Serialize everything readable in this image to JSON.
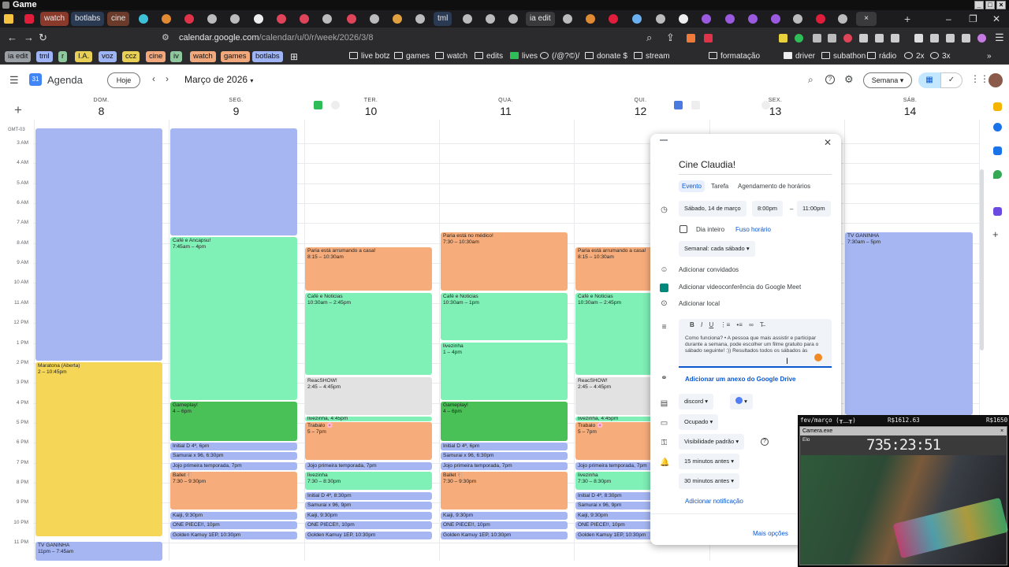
{
  "window": {
    "title": "Game"
  },
  "tabs": [
    "watch",
    "botlabs",
    "cine",
    "tml",
    "ia edit"
  ],
  "address": {
    "domain": "calendar.google.com",
    "path": "/calendar/u/0/r/week/2026/3/8"
  },
  "bookmarks": {
    "chips": [
      {
        "label": "ia edit",
        "color": "#9aa0a6"
      },
      {
        "label": "tml",
        "color": "#9fb4f5"
      },
      {
        "label": "r",
        "color": "#8fc79f"
      },
      {
        "label": "I.A.",
        "color": "#e8cf56"
      },
      {
        "label": "voz",
        "color": "#9fb4f5"
      },
      {
        "label": "ccz",
        "color": "#e8cf56"
      },
      {
        "label": "cine",
        "color": "#f2a87d"
      },
      {
        "label": "iv",
        "color": "#8fc79f"
      },
      {
        "label": "watch",
        "color": "#f2a87d"
      },
      {
        "label": "games",
        "color": "#f2a87d"
      },
      {
        "label": "botlabs",
        "color": "#9fb4f5"
      }
    ],
    "folders": [
      "live botz",
      "games",
      "watch",
      "edits",
      "lives",
      "(/@?©)/",
      "donate $",
      "stream",
      "formatação",
      "driver",
      "subathon",
      "rádio",
      "2x",
      "3x"
    ]
  },
  "calendar": {
    "app_name": "Agenda",
    "today_btn": "Hoje",
    "month": "Março de 2026",
    "view": "Semana",
    "timezone": "GMT-03",
    "hours": [
      "3 AM",
      "4 AM",
      "5 AM",
      "6 AM",
      "7 AM",
      "8 AM",
      "9 AM",
      "10 AM",
      "11 AM",
      "12 PM",
      "1 PM",
      "2 PM",
      "3 PM",
      "4 PM",
      "5 PM",
      "6 PM",
      "7 PM",
      "8 PM",
      "9 PM",
      "10 PM",
      "11 PM"
    ],
    "days": [
      {
        "name": "DOM.",
        "num": "8"
      },
      {
        "name": "SEG.",
        "num": "9"
      },
      {
        "name": "TER.",
        "num": "10"
      },
      {
        "name": "QUA.",
        "num": "11"
      },
      {
        "name": "QUI.",
        "num": "12"
      },
      {
        "name": "SEX.",
        "num": "13"
      },
      {
        "name": "SÁB.",
        "num": "14"
      }
    ],
    "events": {
      "sun": [
        {
          "t": "",
          "time": ""
        },
        {
          "t": "Maratona (Aberta)",
          "time": "2 – 10:45pm"
        },
        {
          "t": "TV GANINHA",
          "time": "11pm – 7:45am"
        }
      ],
      "mon": [
        {
          "t": "",
          "time": ""
        },
        {
          "t": "Café e Ancapsu!",
          "time": "7:45am – 4pm"
        },
        {
          "t": "Gameplay!",
          "time": "4 – 6pm"
        },
        {
          "t": "Initial D 4ª, 6pm",
          "time": ""
        },
        {
          "t": "Samurai x 96, 6:30pm",
          "time": ""
        },
        {
          "t": "Jojo primeira temporada, 7pm",
          "time": ""
        },
        {
          "t": "Ballet 🩰",
          "time": "7:30 – 9:30pm"
        },
        {
          "t": "Kaiji, 9:30pm",
          "time": ""
        },
        {
          "t": "ONE PIECE!!, 10pm",
          "time": ""
        },
        {
          "t": "Golden Kamuy 1EP, 10:30pm",
          "time": ""
        }
      ],
      "tue": [
        {
          "t": "Paria está arrumando a casa!",
          "time": "8:15 – 10:30am"
        },
        {
          "t": "Café e Noticias",
          "time": "10:30am – 2:45pm"
        },
        {
          "t": "ReacSHOW!",
          "time": "2:45 – 4:45pm"
        },
        {
          "t": "livezinha, 4:45pm",
          "time": ""
        },
        {
          "t": "Trabalo 🌸",
          "time": "5 – 7pm"
        },
        {
          "t": "Jojo primeira temporada, 7pm",
          "time": ""
        },
        {
          "t": "livezinha",
          "time": "7:30 – 8:30pm"
        },
        {
          "t": "Initial D 4ª, 8:30pm",
          "time": ""
        },
        {
          "t": "Samurai x 96, 9pm",
          "time": ""
        },
        {
          "t": "Kaiji, 9:30pm",
          "time": ""
        },
        {
          "t": "ONE PIECE!!, 10pm",
          "time": ""
        },
        {
          "t": "Golden Kamuy 1EP, 10:30pm",
          "time": ""
        }
      ],
      "wed": [
        {
          "t": "Paria está no médico!",
          "time": "7:30 – 10:30am"
        },
        {
          "t": "Café e Noticias",
          "time": "10:30am – 1pm"
        },
        {
          "t": "livezinha",
          "time": "1 – 4pm"
        },
        {
          "t": "Gameplay!",
          "time": "4 – 6pm"
        },
        {
          "t": "Initial D 4ª, 6pm",
          "time": ""
        },
        {
          "t": "Samurai x 96, 6:30pm",
          "time": ""
        },
        {
          "t": "Jojo primeira temporada, 7pm",
          "time": ""
        },
        {
          "t": "Ballet 🩰",
          "time": "7:30 – 9:30pm"
        },
        {
          "t": "Kaiji, 9:30pm",
          "time": ""
        },
        {
          "t": "ONE PIECE!!, 10pm",
          "time": ""
        },
        {
          "t": "Golden Kamuy 1EP, 10:30pm",
          "time": ""
        }
      ],
      "thu": [
        {
          "t": "Paria está arrumando a casa!",
          "time": "8:15 – 10:30am"
        },
        {
          "t": "Café e Noticias",
          "time": "10:30am – 2:45pm"
        },
        {
          "t": "ReacSHOW!",
          "time": "2:45 – 4:45pm"
        },
        {
          "t": "livezinha, 4:45pm",
          "time": ""
        },
        {
          "t": "Trabalo 🌸",
          "time": "5 – 7pm"
        },
        {
          "t": "Jojo primeira temporada, 7pm",
          "time": ""
        },
        {
          "t": "livezinha",
          "time": "7:30 – 8:30pm"
        },
        {
          "t": "Initial D 4ª, 8:30pm",
          "time": ""
        },
        {
          "t": "Samurai x 96, 9pm",
          "time": ""
        },
        {
          "t": "Kaiji, 9:30pm",
          "time": ""
        },
        {
          "t": "ONE PIECE!!, 10pm",
          "time": ""
        },
        {
          "t": "Golden Kamuy 1EP, 10:30pm",
          "time": ""
        }
      ],
      "sat": [
        {
          "t": "TV GANINHA",
          "time": "7:30am – 5pm"
        }
      ]
    }
  },
  "dialog": {
    "title": "Cine Claudia!",
    "tabs": [
      "Evento",
      "Tarefa",
      "Agendamento de horários"
    ],
    "date": "Sábado, 14 de março",
    "start": "8:00pm",
    "dash": "–",
    "end": "11:00pm",
    "allday": "Dia inteiro",
    "timezone": "Fuso horário",
    "repeat": "Semanal: cada sábado",
    "guests": "Adicionar convidados",
    "meet": "Adicionar videoconferência do Google Meet",
    "location": "Adicionar local",
    "description": "Como funciona? • A pessoa que mais assistir e participar durante a semana, pode escolher um filme gratuito para o sábado seguinte! :)) Resultados todos os sábados às",
    "attachment": "Adicionar um anexo do Google Drive",
    "calendar": "discord",
    "busy": "Ocupado",
    "visibility": "Visibilidade padrão",
    "notif1": "15 minutos antes",
    "notif2": "30 minutos antes",
    "add_notif": "Adicionar notificação",
    "more": "Mais opções"
  },
  "overlay": {
    "left": "fev/março (╥﹏╥)",
    "price1": "R$1612.63",
    "price2": "R$1650",
    "camera": "Camera.exe",
    "label": "Elo",
    "timer": "735:23:51"
  },
  "colors": {
    "blue": "#a5b6f2",
    "green": "#7ff0b6",
    "orange": "#f7ad7b",
    "yellow": "#f5d657",
    "dark_green": "#49c157",
    "gray": "#e2e2e2"
  }
}
